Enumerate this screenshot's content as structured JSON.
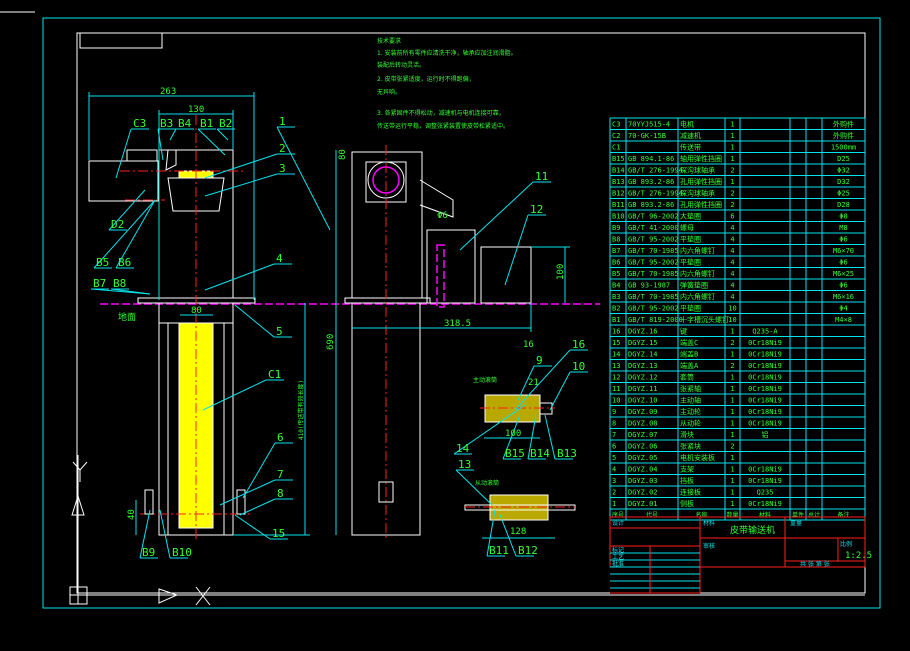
{
  "colors": {
    "background": "#000000",
    "outline": "#ffffff",
    "leader": "#00e5ee",
    "text": "#33ff33",
    "centerline": "#ff2020",
    "hidden": "#ff00ff",
    "belt": "#ffff00"
  },
  "tech_requirements": {
    "title": "技术要求",
    "lines": [
      "1. 安装前所有零件应清洗干净，轴承应加注润滑脂。",
      "装配后转动灵活。",
      "2. 皮带张紧适度，运行时不得跑偏，",
      "无异响。",
      "3. 各紧固件不得松动，减速机与电机连接可靠，",
      "传送带运行平稳，调整张紧装置使皮带松紧适中。"
    ]
  },
  "balloons": [
    "1",
    "2",
    "3",
    "4",
    "5",
    "C1",
    "6",
    "7",
    "8",
    "15",
    "B9",
    "B10",
    "C3",
    "B3",
    "B4",
    "B1",
    "B2",
    "D2",
    "B5",
    "B6",
    "B7",
    "B8",
    "11",
    "12",
    "16",
    "9",
    "10",
    "14",
    "B15",
    "B14",
    "B13",
    "13",
    "B11",
    "B12"
  ],
  "dimensions": [
    "263",
    "130",
    "80",
    "80",
    "410(传送带有效长度)",
    "690",
    "40",
    "318.5",
    "100",
    "16",
    "21",
    "100",
    "128",
    "Φ6",
    "地面"
  ],
  "detail_views": {
    "upper": "主动滚筒",
    "lower": "从动滚筒"
  },
  "bom": {
    "header": [
      "序号",
      "代号",
      "名称",
      "数量",
      "材料",
      "单件",
      "总计",
      "备注"
    ],
    "rows": [
      [
        "C3",
        "70YYJ515-4",
        "电机",
        "1",
        "",
        "",
        "",
        "外购件"
      ],
      [
        "C2",
        "70-GK-15B",
        "减速机",
        "1",
        "",
        "",
        "",
        "外购件"
      ],
      [
        "C1",
        "",
        "传送带",
        "1",
        "",
        "",
        "",
        "1500mm"
      ],
      [
        "B15",
        "GB 894.1-86",
        "轴用弹性挡圈",
        "1",
        "",
        "",
        "",
        "D25"
      ],
      [
        "B14",
        "GB/T 276-1994",
        "深沟球轴承",
        "2",
        "",
        "",
        "",
        "Φ32"
      ],
      [
        "B13",
        "GB 893.2-86",
        "孔用弹性挡圈",
        "1",
        "",
        "",
        "",
        "D32"
      ],
      [
        "B12",
        "GB/T 276-1994",
        "深沟球轴承",
        "2",
        "",
        "",
        "",
        "Φ25"
      ],
      [
        "B11",
        "GB 893.2-86",
        "孔用弹性挡圈",
        "2",
        "",
        "",
        "",
        "D28"
      ],
      [
        "B10",
        "GB/T 96-2002",
        "大垫圈",
        "6",
        "",
        "",
        "",
        "Φ8"
      ],
      [
        "B9",
        "GB/T 41-2000",
        "螺母",
        "4",
        "",
        "",
        "",
        "M8"
      ],
      [
        "B8",
        "GB/T 95-2002",
        "平垫圈",
        "4",
        "",
        "",
        "",
        "Φ6"
      ],
      [
        "B7",
        "GB/T 70-1985",
        "内六角螺钉",
        "4",
        "",
        "",
        "",
        "M6×70"
      ],
      [
        "B6",
        "GB/T 95-2002",
        "平垫圈",
        "4",
        "",
        "",
        "",
        "Φ6"
      ],
      [
        "B5",
        "GB/T 70-1985",
        "内六角螺钉",
        "4",
        "",
        "",
        "",
        "M6×25"
      ],
      [
        "B4",
        "GB 93-1987",
        "弹簧垫圈",
        "4",
        "",
        "",
        "",
        "Φ6"
      ],
      [
        "B3",
        "GB/T 70-1985",
        "内六角螺钉",
        "4",
        "",
        "",
        "",
        "M6×16"
      ],
      [
        "B2",
        "GB/T 95-2002",
        "平垫圈",
        "10",
        "",
        "",
        "",
        "Φ4"
      ],
      [
        "B1",
        "GB/T 819-2000",
        "十字槽沉头螺钉",
        "10",
        "",
        "",
        "",
        "M4×8"
      ],
      [
        "16",
        "DGYZ.16",
        "键",
        "1",
        "Q235-A",
        "",
        "",
        ""
      ],
      [
        "15",
        "DGYZ.15",
        "端盖C",
        "2",
        "0Cr18Ni9",
        "",
        "",
        ""
      ],
      [
        "14",
        "DGYZ.14",
        "端盖B",
        "1",
        "0Cr18Ni9",
        "",
        "",
        ""
      ],
      [
        "13",
        "DGYZ.13",
        "端盖A",
        "2",
        "0Cr18Ni9",
        "",
        "",
        ""
      ],
      [
        "12",
        "DGYZ.12",
        "套筒",
        "1",
        "0Cr18Ni9",
        "",
        "",
        ""
      ],
      [
        "11",
        "DGYZ.11",
        "张紧轴",
        "1",
        "0Cr18Ni9",
        "",
        "",
        ""
      ],
      [
        "10",
        "DGYZ.10",
        "主动轴",
        "1",
        "0Cr18Ni9",
        "",
        "",
        ""
      ],
      [
        "9",
        "DGYZ.09",
        "主动轮",
        "1",
        "0Cr18Ni9",
        "",
        "",
        ""
      ],
      [
        "8",
        "DGYZ.08",
        "从动轮",
        "1",
        "0Cr18Ni9",
        "",
        "",
        ""
      ],
      [
        "7",
        "DGYZ.07",
        "滑块",
        "1",
        "铝",
        "",
        "",
        ""
      ],
      [
        "6",
        "DGYZ.06",
        "张紧块",
        "2",
        "",
        "",
        "",
        ""
      ],
      [
        "5",
        "DGYZ.05",
        "电机安装板",
        "1",
        "",
        "",
        "",
        ""
      ],
      [
        "4",
        "DGYZ.04",
        "支架",
        "1",
        "0Cr18Ni9",
        "",
        "",
        ""
      ],
      [
        "3",
        "DGYZ.03",
        "挡板",
        "1",
        "0Cr18Ni9",
        "",
        "",
        ""
      ],
      [
        "2",
        "DGYZ.02",
        "连接板",
        "1",
        "Q235",
        "",
        "",
        ""
      ],
      [
        "1",
        "DGYZ.01",
        "侧板",
        "1",
        "0Cr18Ni9",
        "",
        "",
        ""
      ]
    ]
  },
  "title_block": {
    "drawing_title": "皮带输送机",
    "scale_label": "比例",
    "scale": "1:2.5",
    "sheet": "共 张 第 张",
    "material_label": "材料",
    "weight_label": "重量",
    "designer_label": "设计",
    "checker_label": "审核",
    "process_label": "工艺",
    "approve_label": "批准",
    "mark": "标记",
    "quantity_label": "数量"
  }
}
